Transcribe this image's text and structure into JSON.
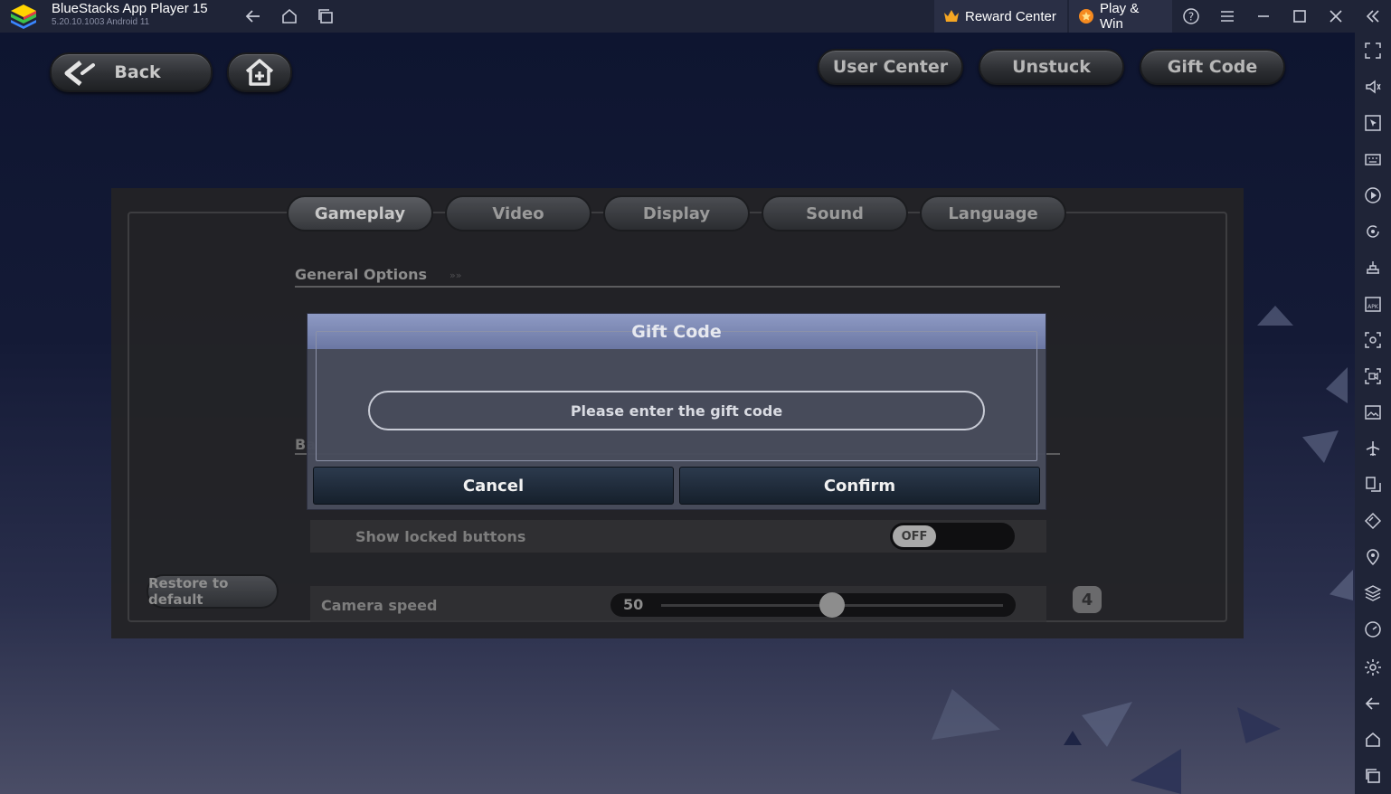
{
  "titlebar": {
    "app_name": "BlueStacks App Player 15",
    "app_version": "5.20.10.1003  Android 11",
    "reward_center": "Reward Center",
    "play_win": "Play & Win"
  },
  "game_nav": {
    "back_label": "Back",
    "user_center": "User Center",
    "unstuck": "Unstuck",
    "gift_code": "Gift Code"
  },
  "settings": {
    "tabs": [
      {
        "label": "Gameplay",
        "active": true
      },
      {
        "label": "Video"
      },
      {
        "label": "Display"
      },
      {
        "label": "Sound"
      },
      {
        "label": "Language"
      }
    ],
    "section_general": "General Options",
    "section_b_partial": "Ba",
    "show_locked_label": "Show locked buttons",
    "show_locked_state": "OFF",
    "restore_label": "Restore to default",
    "camera_speed_label": "Camera speed",
    "camera_speed_value": "50",
    "camera_speed_fraction": 0.5,
    "badge_value": "4"
  },
  "dialog": {
    "title": "Gift Code",
    "input_placeholder": "Please enter the gift code",
    "cancel_label": "Cancel",
    "confirm_label": "Confirm"
  },
  "colors": {
    "titlebar_bg": "#1f2437",
    "dialog_header": "#7e89b5",
    "dialog_button": "#1e2a38"
  }
}
